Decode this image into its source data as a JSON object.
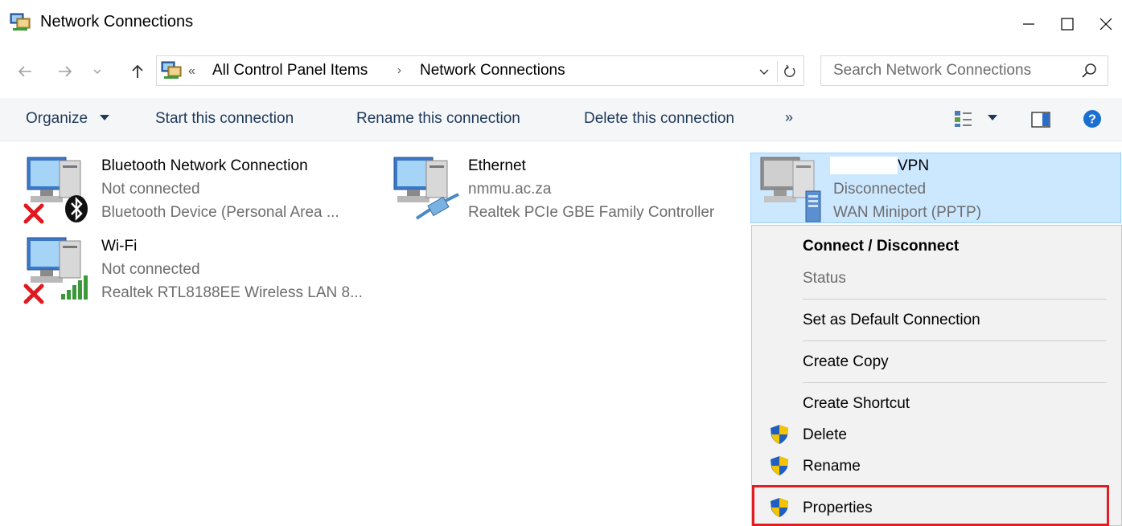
{
  "window": {
    "title": "Network Connections",
    "controls": {
      "minimize": "minimize",
      "maximize": "maximize",
      "close": "close"
    }
  },
  "address": {
    "overflow_glyph": "«",
    "breadcrumb": [
      "All Control Panel Items",
      "Network Connections"
    ],
    "separator": "›",
    "search_placeholder": "Search Network Connections"
  },
  "toolbar": {
    "organize": "Organize",
    "start_connection": "Start this connection",
    "rename_connection": "Rename this connection",
    "delete_connection": "Delete this connection",
    "more": "»"
  },
  "connections": [
    {
      "name": "Bluetooth Network Connection",
      "status": "Not connected",
      "device": "Bluetooth Device (Personal Area ...",
      "badge": "bluetooth-icon",
      "error": true
    },
    {
      "name": "Ethernet",
      "status": "nmmu.ac.za",
      "device": "Realtek PCIe GBE Family Controller",
      "badge": "ethernet-cable-icon",
      "error": false
    },
    {
      "name": "VPN",
      "status": "Disconnected",
      "device": "WAN Miniport (PPTP)",
      "badge": "server-icon",
      "error": false,
      "selected": true
    },
    {
      "name": "Wi-Fi",
      "status": "Not connected",
      "device": "Realtek RTL8188EE Wireless LAN 8...",
      "badge": "wifi-signal-icon",
      "error": true
    }
  ],
  "context_menu": {
    "items": [
      {
        "label": "Connect / Disconnect",
        "bold": true
      },
      {
        "label": "Status",
        "disabled": true
      },
      {
        "label": "Set as Default Connection"
      },
      {
        "label": "Create Copy"
      },
      {
        "label": "Create Shortcut"
      },
      {
        "label": "Delete",
        "shield": true
      },
      {
        "label": "Rename",
        "shield": true
      },
      {
        "label": "Properties",
        "shield": true,
        "highlighted": true
      }
    ]
  },
  "colors": {
    "selection_bg": "#cce8ff",
    "selection_border": "#99d1ff",
    "highlight_border": "#e21d24",
    "command_text": "#1e395b",
    "secondary_text": "#6d6d6d"
  }
}
